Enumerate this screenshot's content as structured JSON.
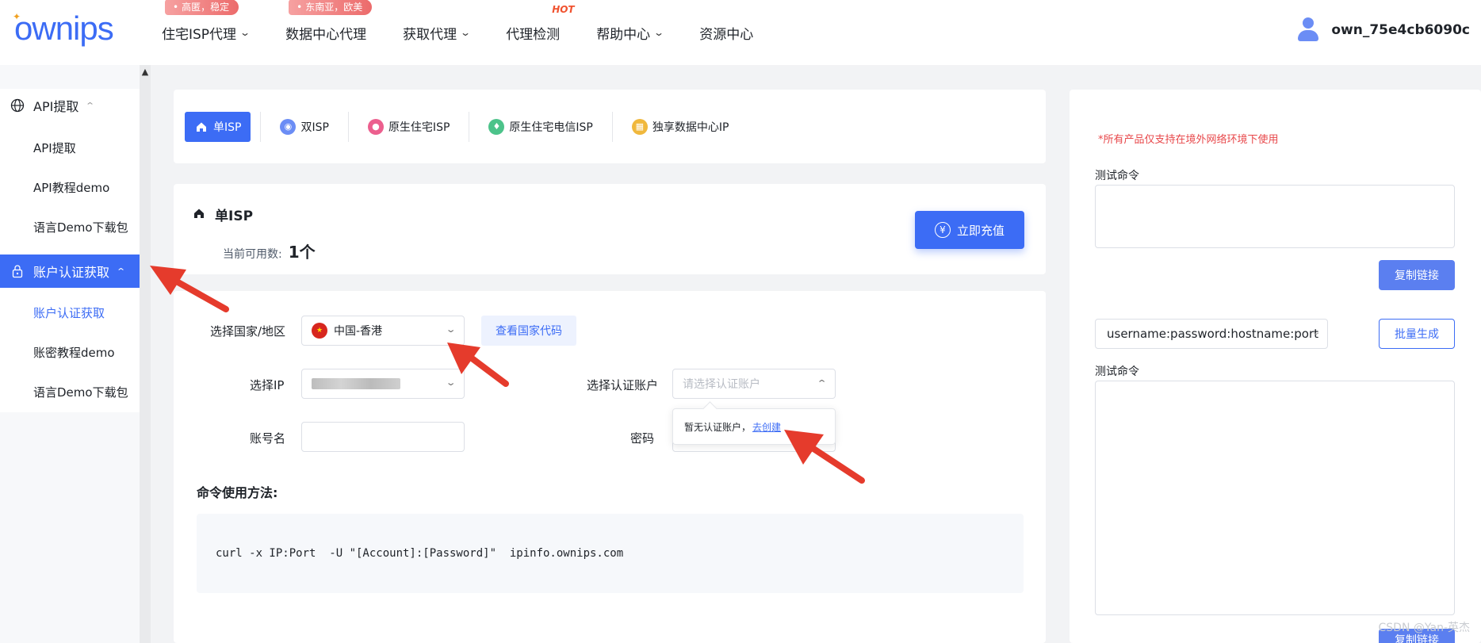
{
  "header": {
    "logo": "ownips",
    "nav": [
      {
        "label": "住宅ISP代理",
        "badge": "高匿，稳定",
        "has_chevron": true
      },
      {
        "label": "数据中心代理",
        "badge": "东南亚，欧美",
        "has_chevron": false
      },
      {
        "label": "获取代理",
        "has_chevron": true
      },
      {
        "label": "代理检测",
        "hot": "HOT",
        "has_chevron": false
      },
      {
        "label": "帮助中心",
        "has_chevron": true
      },
      {
        "label": "资源中心",
        "has_chevron": false
      }
    ],
    "username": "own_75e4cb6090c"
  },
  "sidebar": {
    "groups": [
      {
        "label": "API提取",
        "icon": "globe-icon",
        "active": false,
        "items": [
          "API提取",
          "API教程demo",
          "语言Demo下载包"
        ]
      },
      {
        "label": "账户认证获取",
        "icon": "lock-icon",
        "active": true,
        "items": [
          "账户认证获取",
          "账密教程demo",
          "语言Demo下载包"
        ]
      }
    ]
  },
  "tabs": [
    {
      "label": "单ISP",
      "icon": "home-icon",
      "active": true,
      "color": "#ffffff"
    },
    {
      "label": "双ISP",
      "icon": "location-icon",
      "color": "#6b8df5"
    },
    {
      "label": "原生住宅ISP",
      "icon": "pin-icon",
      "color": "#ec5f8e"
    },
    {
      "label": "原生住宅电信ISP",
      "icon": "bulb-icon",
      "color": "#4cc38a"
    },
    {
      "label": "独享数据中心IP",
      "icon": "grid-icon",
      "color": "#f0b83c"
    }
  ],
  "info": {
    "title": "单ISP",
    "available_label": "当前可用数:",
    "available_value": "1个",
    "recharge_label": "立即充值"
  },
  "form": {
    "country_label": "选择国家/地区",
    "country_value": "中国-香港",
    "country_code_link": "查看国家代码",
    "ip_label": "选择IP",
    "account_label": "选择认证账户",
    "account_placeholder": "请选择认证账户",
    "username_label": "账号名",
    "password_label": "密码",
    "popover_text": "暂无认证账户，",
    "popover_link": "去创建",
    "usage_title": "命令使用方法:",
    "command": "curl -x IP:Port  -U \"[Account]:[Password]\"  ipinfo.ownips.com"
  },
  "right": {
    "notice": "*所有产品仅支持在境外网络环境下使用",
    "test_label_1": "测试命令",
    "copy_label": "复制链接",
    "format_value": "username:password:hostname:port",
    "batch_label": "批量生成",
    "test_label_2": "测试命令",
    "copy_label_2": "复制链接"
  },
  "watermark": "CSDN @Yan-英杰",
  "colors": {
    "primary": "#3c6cf5",
    "danger": "#e8474a",
    "arrow": "#e53b2c"
  }
}
